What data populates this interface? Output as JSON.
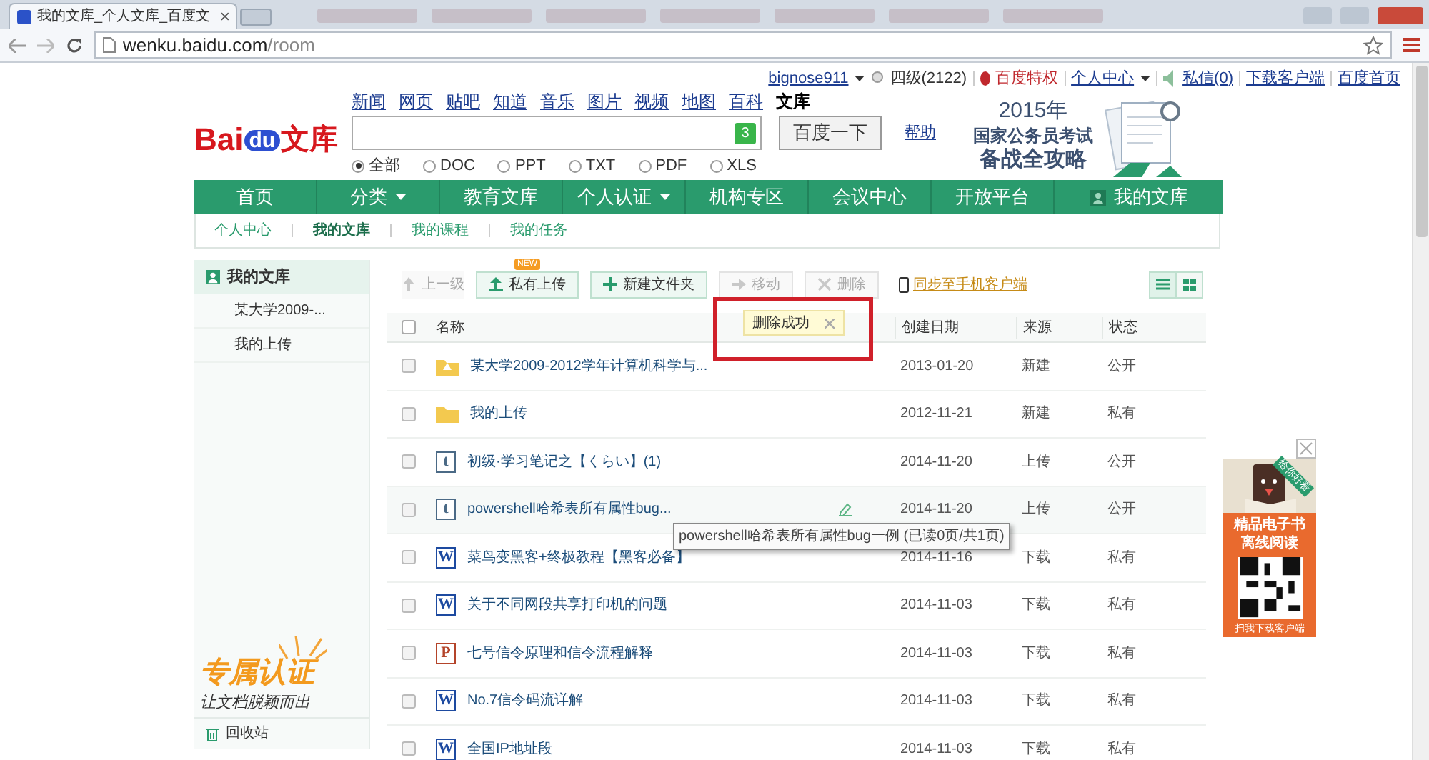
{
  "browser": {
    "tab_title": "我的文库_个人文库_百度文",
    "url_host": "wenku.baidu.com",
    "url_path": "/room"
  },
  "top_links": [
    {
      "label": "bignose911",
      "kind": "user"
    },
    {
      "label": "四级(2122)",
      "kind": "level"
    },
    {
      "label": "百度特权",
      "kind": "privilege"
    },
    {
      "label": "个人中心",
      "kind": "menu"
    },
    {
      "label": "私信(0)",
      "kind": "message"
    },
    {
      "label": "下载客户端",
      "kind": "link"
    },
    {
      "label": "百度首页",
      "kind": "link"
    }
  ],
  "logo": {
    "brand_left": "Bai",
    "brand_mid": "du",
    "brand_right": "文库"
  },
  "channels": [
    {
      "label": "新闻",
      "selected": false
    },
    {
      "label": "网页",
      "selected": false
    },
    {
      "label": "贴吧",
      "selected": false
    },
    {
      "label": "知道",
      "selected": false
    },
    {
      "label": "音乐",
      "selected": false
    },
    {
      "label": "图片",
      "selected": false
    },
    {
      "label": "视频",
      "selected": false
    },
    {
      "label": "地图",
      "selected": false
    },
    {
      "label": "百科",
      "selected": false
    },
    {
      "label": "文库",
      "selected": true
    }
  ],
  "search": {
    "badge": "3",
    "button": "百度一下",
    "help": "帮助"
  },
  "filetypes": [
    {
      "label": "全部",
      "selected": true
    },
    {
      "label": "DOC",
      "selected": false
    },
    {
      "label": "PPT",
      "selected": false
    },
    {
      "label": "TXT",
      "selected": false
    },
    {
      "label": "PDF",
      "selected": false
    },
    {
      "label": "XLS",
      "selected": false
    }
  ],
  "banner": {
    "year": "2015年",
    "line1": "国家公务员考试",
    "line2": "备战全攻略"
  },
  "main_nav": [
    {
      "label": "首页",
      "dropdown": false,
      "kind": "plain"
    },
    {
      "label": "分类",
      "dropdown": true,
      "kind": "plain"
    },
    {
      "label": "教育文库",
      "dropdown": false,
      "kind": "plain"
    },
    {
      "label": "个人认证",
      "dropdown": true,
      "kind": "plain"
    },
    {
      "label": "机构专区",
      "dropdown": false,
      "kind": "plain"
    },
    {
      "label": "会议中心",
      "dropdown": false,
      "kind": "plain"
    },
    {
      "label": "开放平台",
      "dropdown": false,
      "kind": "plain"
    },
    {
      "label": "我的文库",
      "dropdown": false,
      "kind": "user"
    }
  ],
  "sub_nav": [
    {
      "label": "个人中心",
      "selected": false
    },
    {
      "label": "我的文库",
      "selected": true
    },
    {
      "label": "我的课程",
      "selected": false
    },
    {
      "label": "我的任务",
      "selected": false
    }
  ],
  "sidebar": {
    "title": "我的文库",
    "items": [
      {
        "label": "某大学2009-..."
      },
      {
        "label": "我的上传"
      }
    ],
    "promo_title": "专属认证",
    "promo_slogan": "让文档脱颖而出",
    "trash": "回收站"
  },
  "toolbar": [
    {
      "label": "上一级",
      "kind": "up",
      "disabled": true
    },
    {
      "label": "私有上传",
      "kind": "upload",
      "disabled": false,
      "badge": "NEW"
    },
    {
      "label": "新建文件夹",
      "kind": "new",
      "disabled": false
    },
    {
      "label": "移动",
      "kind": "move",
      "disabled": true
    },
    {
      "label": "删除",
      "kind": "delete",
      "disabled": true
    }
  ],
  "sync_link": "同步至手机客户端",
  "views": [
    {
      "kind": "list",
      "selected": true
    },
    {
      "kind": "grid",
      "selected": false
    }
  ],
  "table": {
    "all_checked": false,
    "columns": [
      "名称",
      "创建日期",
      "来源",
      "状态"
    ],
    "rows": [
      {
        "kind": "folder-shared",
        "name": "某大学2009-2012学年计算机科学与...",
        "date": "2013-01-20",
        "source": "新建",
        "status": "公开",
        "hovered": false,
        "checked": false
      },
      {
        "kind": "folder",
        "name": "我的上传",
        "date": "2012-11-21",
        "source": "新建",
        "status": "私有",
        "hovered": false,
        "checked": false
      },
      {
        "kind": "txt",
        "badge": "t",
        "name": "初级·学习笔记之【くらい】(1)",
        "date": "2014-11-20",
        "source": "上传",
        "status": "公开",
        "hovered": false,
        "checked": false
      },
      {
        "kind": "txt",
        "badge": "t",
        "name": "powershell哈希表所有属性bug...",
        "date": "2014-11-20",
        "source": "上传",
        "status": "公开",
        "hovered": true,
        "checked": false
      },
      {
        "kind": "word",
        "badge": "W",
        "name": "菜鸟变黑客+终极教程【黑客必备】",
        "date": "2014-11-16",
        "source": "下载",
        "status": "私有",
        "hovered": false,
        "checked": false
      },
      {
        "kind": "word",
        "badge": "W",
        "name": "关于不同网段共享打印机的问题",
        "date": "2014-11-03",
        "source": "下载",
        "status": "私有",
        "hovered": false,
        "checked": false
      },
      {
        "kind": "ppt",
        "badge": "P",
        "name": "七号信令原理和信令流程解释",
        "date": "2014-11-03",
        "source": "下载",
        "status": "私有",
        "hovered": false,
        "checked": false
      },
      {
        "kind": "word",
        "badge": "W",
        "name": "No.7信令码流详解",
        "date": "2014-11-03",
        "source": "下载",
        "status": "私有",
        "hovered": false,
        "checked": false
      },
      {
        "kind": "word",
        "badge": "W",
        "name": "全国IP地址段",
        "date": "2014-11-03",
        "source": "下载",
        "status": "私有",
        "hovered": false,
        "checked": false
      }
    ]
  },
  "toast": "删除成功",
  "tooltip": "powershell哈希表所有属性bug一例 (已读0页/共1页)",
  "ad": {
    "ribbon": "给你好看",
    "line1": "精品电子书",
    "line2": "离线阅读",
    "footer": "扫我下载客户端"
  }
}
